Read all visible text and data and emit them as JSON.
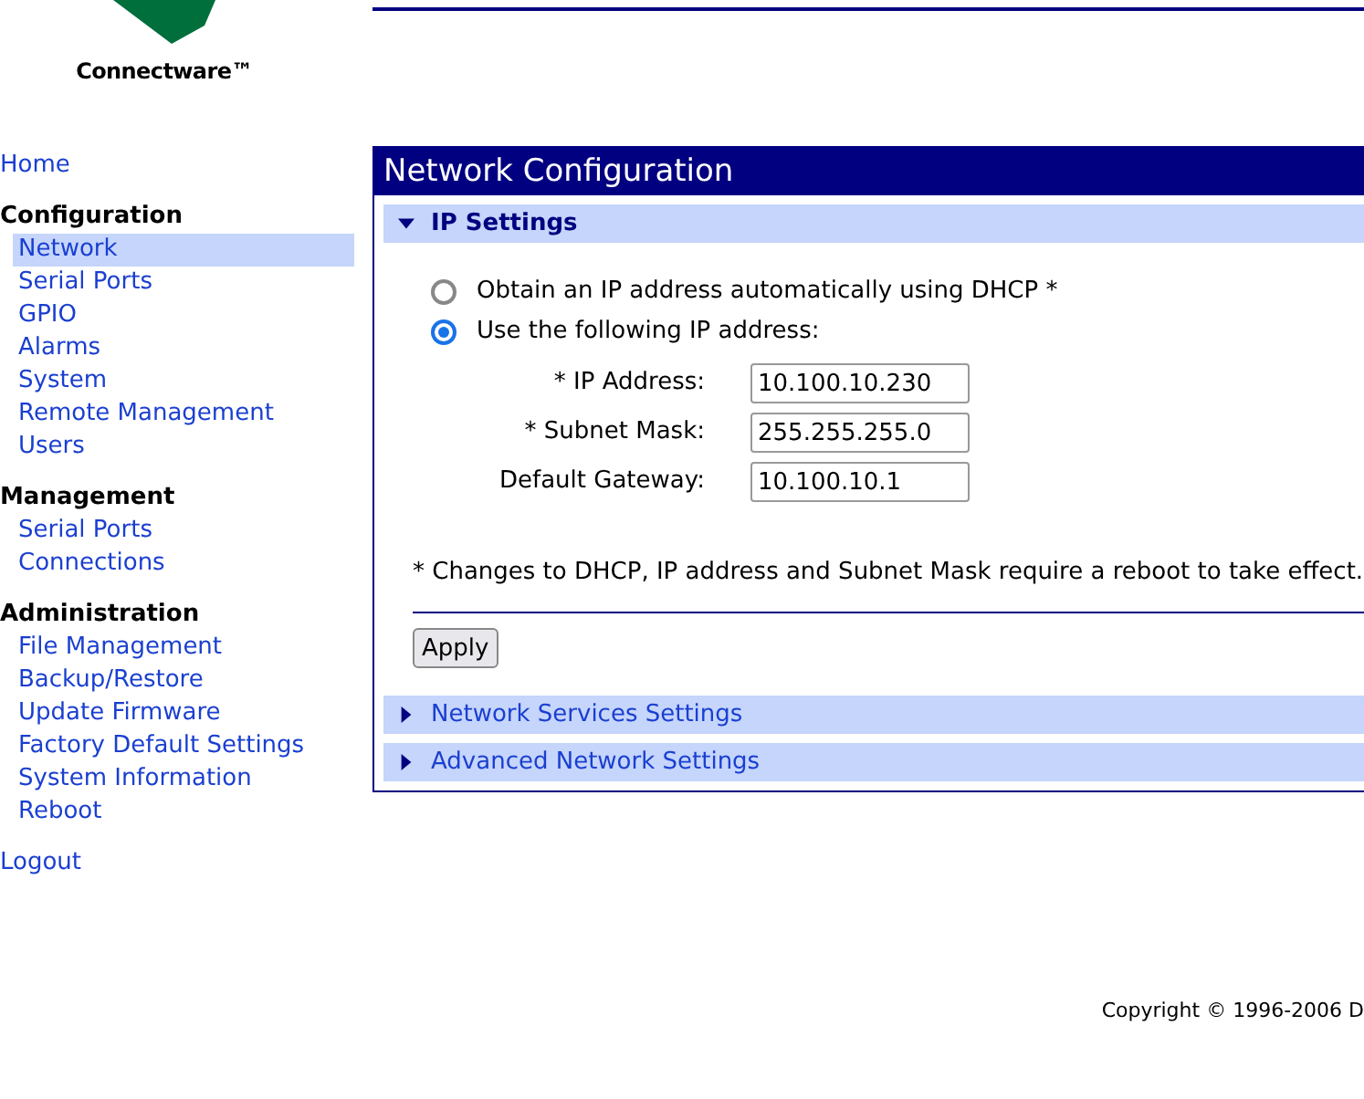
{
  "logo": {
    "brand": "Connectware™"
  },
  "nav": [
    {
      "kind": "link",
      "label": "Home",
      "selected": false
    },
    {
      "kind": "heading",
      "label": "Configuration"
    },
    {
      "kind": "item",
      "label": "Network",
      "selected": true
    },
    {
      "kind": "item",
      "label": "Serial Ports",
      "selected": false
    },
    {
      "kind": "item",
      "label": "GPIO",
      "selected": false
    },
    {
      "kind": "item",
      "label": "Alarms",
      "selected": false
    },
    {
      "kind": "item",
      "label": "System",
      "selected": false
    },
    {
      "kind": "item",
      "label": "Remote Management",
      "selected": false
    },
    {
      "kind": "item",
      "label": "Users",
      "selected": false
    },
    {
      "kind": "heading",
      "label": "Management"
    },
    {
      "kind": "item",
      "label": "Serial Ports",
      "selected": false
    },
    {
      "kind": "item",
      "label": "Connections",
      "selected": false
    },
    {
      "kind": "heading",
      "label": "Administration"
    },
    {
      "kind": "item",
      "label": "File Management",
      "selected": false
    },
    {
      "kind": "item",
      "label": "Backup/Restore",
      "selected": false
    },
    {
      "kind": "item",
      "label": "Update Firmware",
      "selected": false
    },
    {
      "kind": "item",
      "label": "Factory Default Settings",
      "selected": false
    },
    {
      "kind": "item",
      "label": "System Information",
      "selected": false
    },
    {
      "kind": "item",
      "label": "Reboot",
      "selected": false
    },
    {
      "kind": "link",
      "label": "Logout",
      "selected": false
    }
  ],
  "panel": {
    "title": "Network Configuration",
    "sections": [
      {
        "title": "IP Settings",
        "expanded": true,
        "radios": [
          {
            "label": "Obtain an IP address automatically using DHCP *",
            "selected": false
          },
          {
            "label": "Use the following IP address:",
            "selected": true
          }
        ],
        "fields": [
          {
            "label": "* IP Address:",
            "value": "10.100.10.230"
          },
          {
            "label": "* Subnet Mask:",
            "value": "255.255.255.0"
          },
          {
            "label": "Default Gateway:",
            "value": "10.100.10.1"
          }
        ],
        "note": "* Changes to DHCP, IP address and Subnet Mask require a reboot to take effect.",
        "button": "Apply"
      },
      {
        "title": "Network Services Settings",
        "expanded": false
      },
      {
        "title": "Advanced Network Settings",
        "expanded": false
      }
    ]
  },
  "footer": {
    "copyright": "Copyright © 1996-2006 D"
  }
}
